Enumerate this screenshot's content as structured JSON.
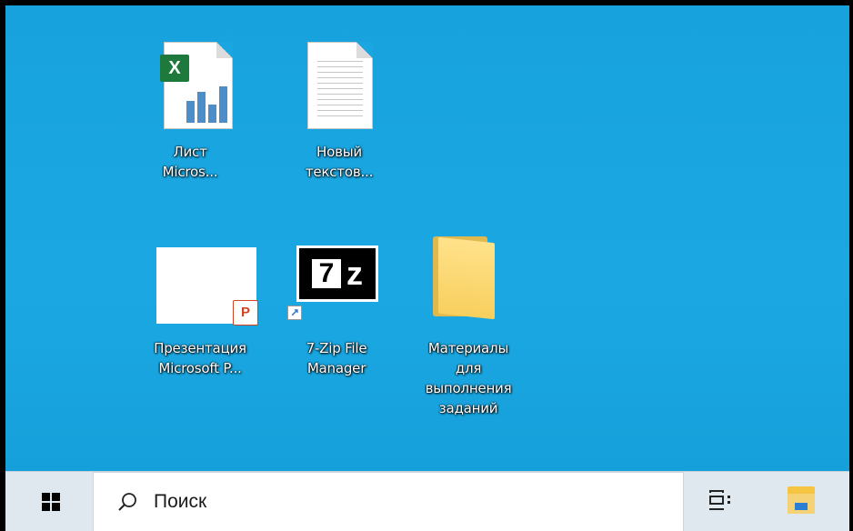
{
  "desktop": {
    "icons": [
      {
        "label": "Лист\nMicros...",
        "type": "excel"
      },
      {
        "label": "Новый\nтекстов...",
        "type": "text"
      },
      {
        "label": "Презентация\nMicrosoft P...",
        "type": "powerpoint",
        "badge": "P"
      },
      {
        "label": "7-Zip File\nManager",
        "type": "7zip",
        "glyph_seven": "7",
        "glyph_z": "z"
      },
      {
        "label": "Материалы\nдля\nвыполнения\nзаданий",
        "type": "folder"
      }
    ],
    "excel_badge": "X"
  },
  "taskbar": {
    "search_placeholder": "Поиск",
    "start_icon": "windows-logo-icon",
    "taskview_icon": "task-view-icon",
    "explorer_icon": "file-explorer-icon"
  },
  "colors": {
    "desktop_bg": "#1aa6e0",
    "taskbar_bg": "#dfe7ef"
  }
}
